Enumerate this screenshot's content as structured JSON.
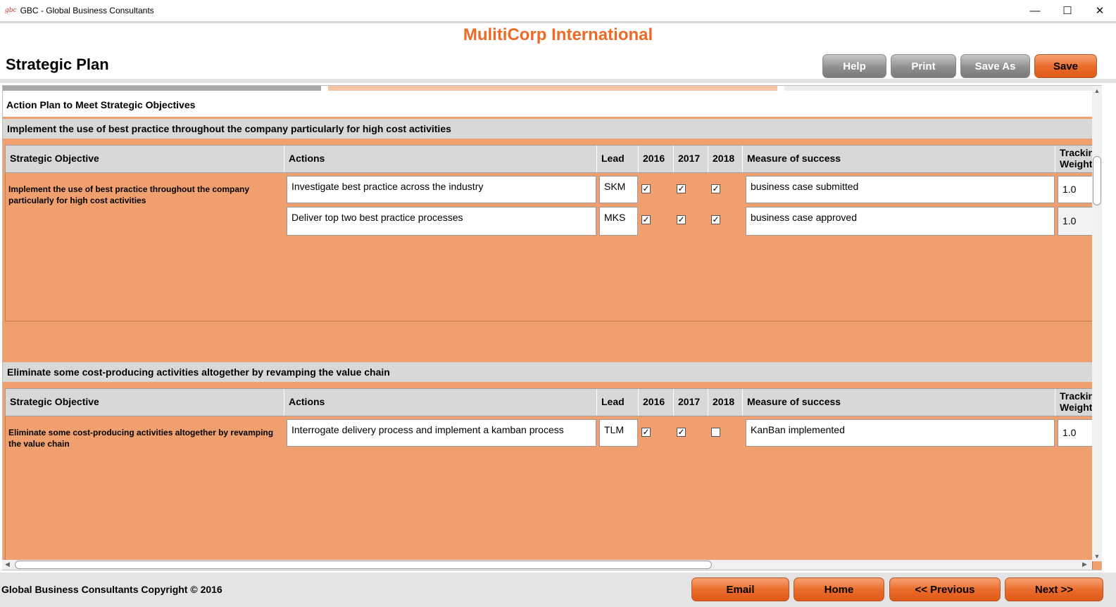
{
  "window": {
    "icon_text": "gbc",
    "title": "GBC - Global Business Consultants",
    "controls": {
      "minimize": "—",
      "maximize": "☐",
      "close": "✕"
    }
  },
  "header": {
    "company": "MulitiCorp International",
    "page_title": "Strategic Plan",
    "buttons": {
      "help": "Help",
      "print": "Print",
      "save_as": "Save As",
      "save": "Save"
    }
  },
  "plan": {
    "title": "Action Plan to Meet Strategic Objectives",
    "columns": {
      "objective": "Strategic Objective",
      "actions": "Actions",
      "lead": "Lead",
      "y2016": "2016",
      "y2017": "2017",
      "y2018": "2018",
      "measure": "Measure of success",
      "tracking": "Tracking Weight"
    },
    "sections": [
      {
        "heading": "Implement the use of best practice throughout the company particularly for high cost activities",
        "objective": "Implement the use of best practice throughout the company particularly for high cost activities",
        "rows": [
          {
            "action": "Investigate best practice across the industry",
            "lead": "SKM",
            "y2016": "✓",
            "y2017": "✓",
            "y2018": "✓",
            "measure": "business case submitted",
            "weight": "1.0"
          },
          {
            "action": "Deliver top two best practice processes",
            "lead": "MKS",
            "y2016": "✓",
            "y2017": "✓",
            "y2018": "✓",
            "measure": "business case approved",
            "weight": "1.0"
          }
        ]
      },
      {
        "heading": "Eliminate some cost-producing activities altogether by revamping the value chain",
        "objective": "Eliminate some cost-producing activities altogether by revamping the value chain",
        "rows": [
          {
            "action": "Interrogate delivery process and implement a kamban process",
            "lead": "TLM",
            "y2016": "✓",
            "y2017": "✓",
            "y2018": "",
            "measure": "KanBan implemented",
            "weight": "1.0"
          }
        ]
      }
    ]
  },
  "scroll": {
    "up": "▲",
    "down": "▼",
    "left": "◀",
    "right": "▶"
  },
  "footer": {
    "copyright": "Global Business Consultants Copyright © 2016",
    "buttons": {
      "email": "Email",
      "home": "Home",
      "previous": "<< Previous",
      "next": "Next >>"
    }
  }
}
